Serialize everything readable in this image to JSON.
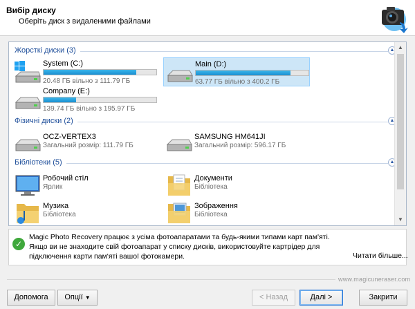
{
  "header": {
    "title": "Вибір диску",
    "subtitle": "Оберіть диск з видаленими файлами",
    "icon": "camera-recovery-icon"
  },
  "groups": {
    "hard": "Жорсткі диски (3)",
    "physical": "Фізичні диски (2)",
    "libraries": "Бібліотеки (5)"
  },
  "hard_drives": [
    {
      "name": "System (C:)",
      "free": "20.48 ГБ вільно з 111.79 ГБ",
      "used_fraction": 0.82,
      "icon": "windows-system-drive-icon"
    },
    {
      "name": "Main (D:)",
      "free": "63.77 ГБ вільно з 400.2 ГБ",
      "used_fraction": 0.84,
      "icon": "hard-drive-icon"
    },
    {
      "name": "Company (E:)",
      "free": "139.74 ГБ вільно з 195.97 ГБ",
      "used_fraction": 0.29,
      "icon": "hard-drive-icon"
    }
  ],
  "physical_disks": [
    {
      "name": "OCZ-VERTEX3",
      "size": "Загальний розмір: 111.79 ГБ",
      "icon": "hard-drive-icon"
    },
    {
      "name": "SAMSUNG HM641JI",
      "size": "Загальний розмір: 596.17 ГБ",
      "icon": "hard-drive-icon"
    }
  ],
  "libraries": [
    {
      "name": "Робочий стіл",
      "type": "Ярлик",
      "icon": "desktop-icon"
    },
    {
      "name": "Документи",
      "type": "Бібліотека",
      "icon": "documents-folder-icon"
    },
    {
      "name": "Музика",
      "type": "Бібліотека",
      "icon": "music-folder-icon"
    },
    {
      "name": "Зображення",
      "type": "Бібліотека",
      "icon": "pictures-folder-icon"
    }
  ],
  "info": {
    "text": "Magic Photo Recovery працює з усіма фотоапаратами та будь-якими типами карт пам'яті.\nЯкщо ви не знаходите свій фотоапарат у списку дисків, використовуйте картрідер для підключення карти пам'яті вашої фотокамери.",
    "more_link": "Читати більше..."
  },
  "watermark": "www.magicuneraser.com",
  "buttons": {
    "help": "Допомога",
    "options": "Опції",
    "back": "< Назад",
    "next": "Далі >",
    "close": "Закрити"
  },
  "colors": {
    "accent": "#1e4e9a",
    "selection": "#cde6f7",
    "bar": "#26a0da"
  }
}
